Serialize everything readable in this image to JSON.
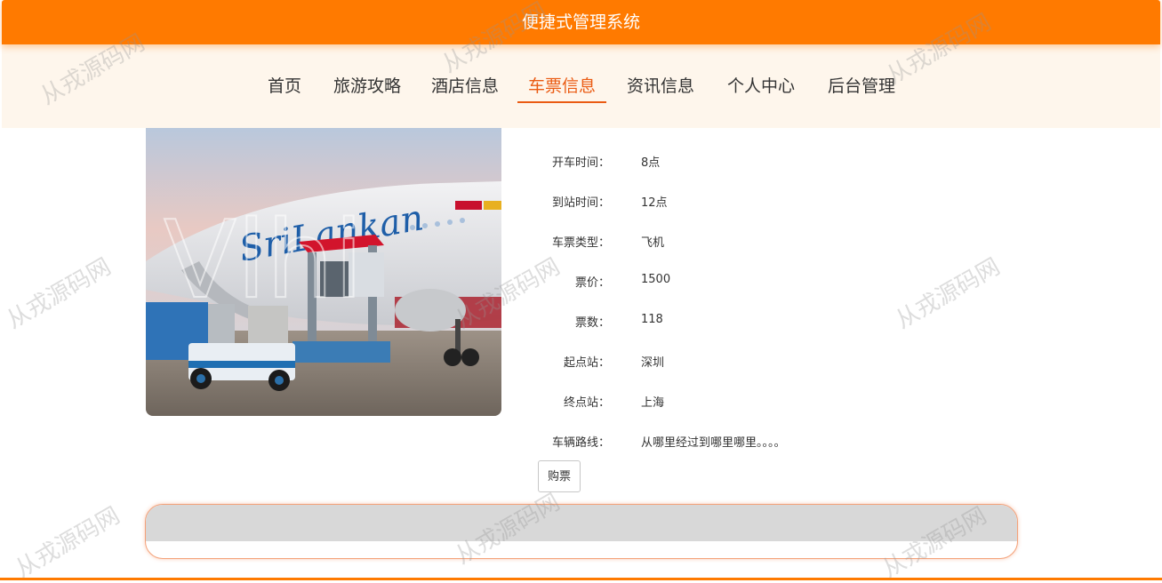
{
  "header": {
    "title": "便捷式管理系统"
  },
  "nav": {
    "items": [
      {
        "label": "首页"
      },
      {
        "label": "旅游攻略"
      },
      {
        "label": "酒店信息"
      },
      {
        "label": "车票信息"
      },
      {
        "label": "资讯信息"
      },
      {
        "label": "个人中心"
      },
      {
        "label": "后台管理"
      }
    ],
    "active": "车票信息"
  },
  "image": {
    "overlay_text": "Vlhi",
    "icon": "airplane-cargo-photo"
  },
  "ticket": {
    "fields": [
      {
        "label": "开车时间：",
        "value": "8点"
      },
      {
        "label": "到站时间：",
        "value": "12点"
      },
      {
        "label": "车票类型：",
        "value": "飞机"
      },
      {
        "label": "票价：",
        "value": "1500"
      },
      {
        "label": "票数：",
        "value": "118"
      },
      {
        "label": "起点站：",
        "value": "深圳"
      },
      {
        "label": "终点站：",
        "value": "上海"
      },
      {
        "label": "车辆路线：",
        "value": "从哪里经过到哪里哪里。。。。"
      }
    ]
  },
  "actions": {
    "buy_label": "购票"
  },
  "watermark": {
    "text": "从戎源码网"
  },
  "colors": {
    "brand": "#ff7a00",
    "nav_bg": "#fef6ec",
    "active": "#ea5b13"
  }
}
